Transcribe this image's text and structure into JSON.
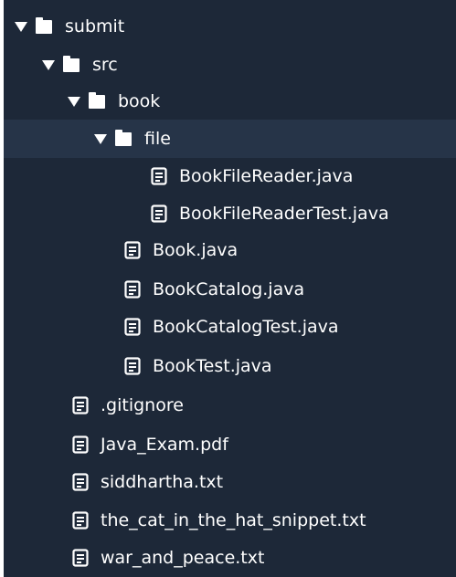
{
  "tree": {
    "background": "#1d2838",
    "selected_background": "#263448",
    "items": [
      {
        "name": "submit",
        "type": "folder",
        "expanded": true
      },
      {
        "name": "src",
        "type": "folder",
        "expanded": true
      },
      {
        "name": "book",
        "type": "folder",
        "expanded": true
      },
      {
        "name": "file",
        "type": "folder",
        "expanded": true,
        "selected": true
      },
      {
        "name": "BookFileReader.java",
        "type": "file",
        "icon": "file-icon"
      },
      {
        "name": "BookFileReaderTest.java",
        "type": "file",
        "icon": "file-icon"
      },
      {
        "name": "Book.java",
        "type": "file",
        "icon": "file-icon"
      },
      {
        "name": "BookCatalog.java",
        "type": "file",
        "icon": "file-icon"
      },
      {
        "name": "BookCatalogTest.java",
        "type": "file",
        "icon": "file-icon"
      },
      {
        "name": "BookTest.java",
        "type": "file",
        "icon": "file-icon"
      },
      {
        "name": ".gitignore",
        "type": "file",
        "icon": "file-icon"
      },
      {
        "name": "Java_Exam.pdf",
        "type": "file",
        "icon": "file-icon"
      },
      {
        "name": "siddhartha.txt",
        "type": "file",
        "icon": "file-icon"
      },
      {
        "name": "the_cat_in_the_hat_snippet.txt",
        "type": "file",
        "icon": "file-icon"
      },
      {
        "name": "war_and_peace.txt",
        "type": "file",
        "icon": "file-icon"
      }
    ]
  }
}
